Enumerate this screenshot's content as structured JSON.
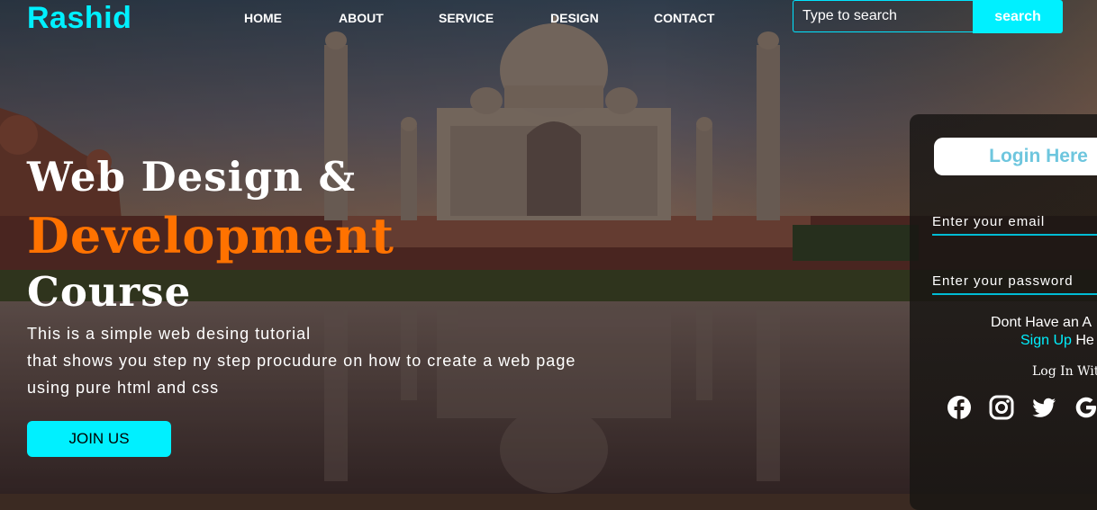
{
  "header": {
    "logo": "Rashid",
    "nav": [
      "HOME",
      "ABOUT",
      "SERVICE",
      "DESIGN",
      "CONTACT"
    ],
    "search": {
      "placeholder": "Type to search",
      "button_label": "search"
    }
  },
  "hero": {
    "line1": "Web Design &",
    "line2": "Development",
    "line3": "Course",
    "paragraph": [
      "This is a simple web desing tutorial",
      "that shows you step ny step procudure on how to create a web page",
      "using pure html and css"
    ],
    "cta_label": "JOIN US"
  },
  "login": {
    "title": "Login Here",
    "email_placeholder": "Enter your email",
    "password_placeholder": "Enter your password",
    "account_prompt": "Dont Have an A",
    "signup_link": "Sign Up",
    "signup_suffix": " He",
    "login_with": "Log In With",
    "social_icons": [
      "facebook-icon",
      "instagram-icon",
      "twitter-icon",
      "google-icon"
    ]
  },
  "colors": {
    "accent": "#00f0ff",
    "orange": "#ff7200",
    "card_title": "#6ec6de"
  }
}
